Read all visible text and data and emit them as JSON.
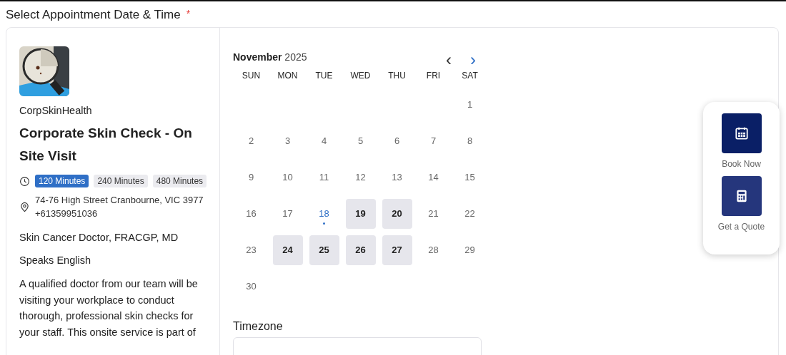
{
  "heading": {
    "title": "Select Appointment Date & Time",
    "required_mark": "*"
  },
  "service": {
    "provider": "CorpSkinHealth",
    "title": "Corporate Skin Check - On Site Visit",
    "durations": [
      {
        "label": "120 Minutes",
        "selected": true
      },
      {
        "label": "240 Minutes",
        "selected": false
      },
      {
        "label": "480 Minutes",
        "selected": false
      }
    ],
    "address": "74-76 High Street Cranbourne, VIC 3977",
    "phone": "+61359951036",
    "credentials": "Skin Cancer Doctor, FRACGP, MD",
    "languages": "Speaks English",
    "description": "A qualified doctor from our team will be visiting your workplace to conduct thorough, professional skin checks for your staff. This onsite service is part of"
  },
  "calendar": {
    "month": "November",
    "year": "2025",
    "prev": "‹",
    "next": "›",
    "weekdays": [
      "SUN",
      "MON",
      "TUE",
      "WED",
      "THU",
      "FRI",
      "SAT"
    ],
    "weeks": [
      [
        {
          "day": "1",
          "available": false,
          "today": false
        }
      ],
      [
        {
          "day": "2",
          "available": false,
          "today": false
        },
        {
          "day": "3",
          "available": false,
          "today": false
        },
        {
          "day": "4",
          "available": false,
          "today": false
        },
        {
          "day": "5",
          "available": false,
          "today": false
        },
        {
          "day": "6",
          "available": false,
          "today": false
        },
        {
          "day": "7",
          "available": false,
          "today": false
        },
        {
          "day": "8",
          "available": false,
          "today": false
        }
      ],
      [
        {
          "day": "9",
          "available": false,
          "today": false
        },
        {
          "day": "10",
          "available": false,
          "today": false
        },
        {
          "day": "11",
          "available": false,
          "today": false
        },
        {
          "day": "12",
          "available": false,
          "today": false
        },
        {
          "day": "13",
          "available": false,
          "today": false
        },
        {
          "day": "14",
          "available": false,
          "today": false
        },
        {
          "day": "15",
          "available": false,
          "today": false
        }
      ],
      [
        {
          "day": "16",
          "available": false,
          "today": false
        },
        {
          "day": "17",
          "available": false,
          "today": false
        },
        {
          "day": "18",
          "available": false,
          "today": true
        },
        {
          "day": "19",
          "available": true,
          "today": false
        },
        {
          "day": "20",
          "available": true,
          "today": false
        },
        {
          "day": "21",
          "available": false,
          "today": false
        },
        {
          "day": "22",
          "available": false,
          "today": false
        }
      ],
      [
        {
          "day": "23",
          "available": false,
          "today": false
        },
        {
          "day": "24",
          "available": true,
          "today": false
        },
        {
          "day": "25",
          "available": true,
          "today": false
        },
        {
          "day": "26",
          "available": true,
          "today": false
        },
        {
          "day": "27",
          "available": true,
          "today": false
        },
        {
          "day": "28",
          "available": false,
          "today": false
        },
        {
          "day": "29",
          "available": false,
          "today": false
        }
      ],
      [
        {
          "day": "30",
          "available": false,
          "today": false
        }
      ]
    ],
    "timezone_label": "Timezone"
  },
  "widget": [
    {
      "label": "Book Now",
      "kind": "calendar"
    },
    {
      "label": "Get a Quote",
      "kind": "calculator"
    }
  ]
}
